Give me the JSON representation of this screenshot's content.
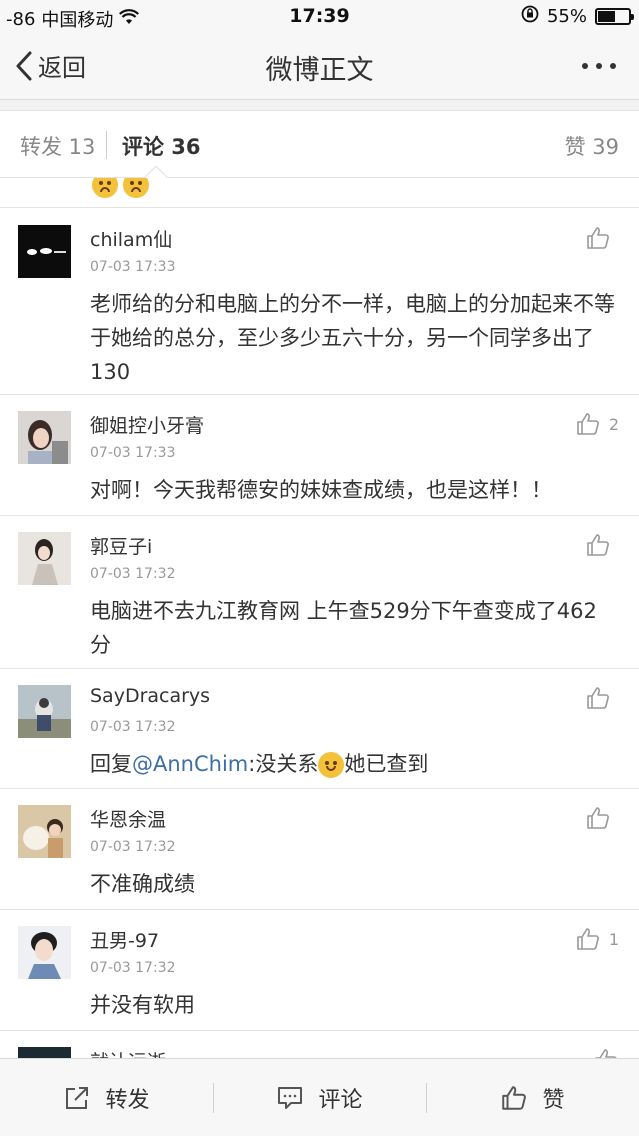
{
  "status_bar": {
    "signal": "-86",
    "carrier": "中国移动",
    "time": "17:39",
    "battery_percent": "55%",
    "battery_level": 0.55
  },
  "nav": {
    "back_label": "返回",
    "title": "微博正文"
  },
  "tabs": {
    "repost": "转发 13",
    "comment": "评论 36",
    "like": "赞 39"
  },
  "comments": [
    {
      "user": "chilam仙",
      "time": "07-03 17:33",
      "text": "老师给的分和电脑上的分不一样，电脑上的分加起来不等于她给的总分，至少多少五六十分，另一个同学多出了130",
      "likes": ""
    },
    {
      "user": "御姐控小牙膏",
      "time": "07-03 17:33",
      "text": "对啊！今天我帮德安的妹妹查成绩，也是这样！！",
      "likes": "2"
    },
    {
      "user": "郭豆子i",
      "time": "07-03 17:32",
      "text": "电脑进不去九江教育网 上午查529分下午查变成了462分",
      "likes": ""
    },
    {
      "user": "SayDracarys",
      "time": "07-03 17:32",
      "text_prefix": "回复",
      "mention": "@AnnChim",
      "text_middle": ":没关系",
      "text_suffix": "她已查到",
      "likes": ""
    },
    {
      "user": "华恩余温",
      "time": "07-03 17:32",
      "text": "不准确成绩",
      "likes": ""
    },
    {
      "user": "丑男-97",
      "time": "07-03 17:32",
      "text": "并没有软用",
      "likes": "1"
    },
    {
      "user": "就让远逝",
      "time": "",
      "text": "",
      "likes": ""
    }
  ],
  "bottom_bar": {
    "repost": "转发",
    "comment": "评论",
    "like": "赞"
  },
  "colors": {
    "mention": "#3d6ea8",
    "muted": "#999999"
  }
}
